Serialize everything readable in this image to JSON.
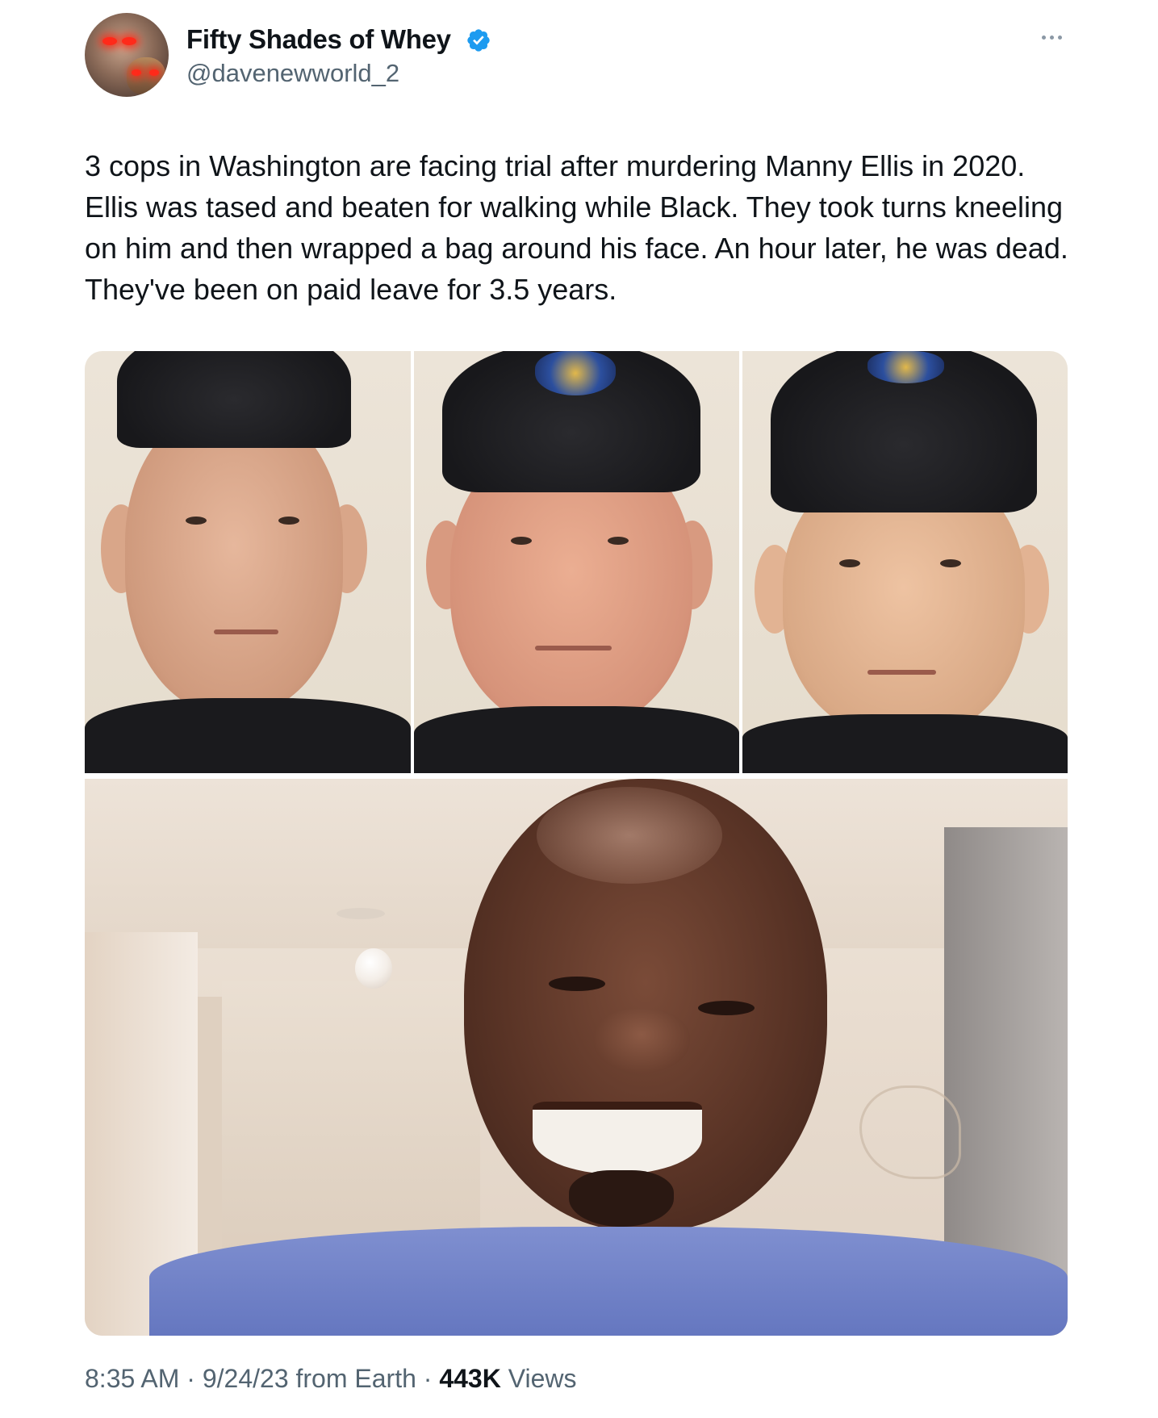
{
  "author": {
    "display_name": "Fifty Shades of Whey",
    "handle": "@davenewworld_2",
    "verified": true,
    "avatar_icon": "profile-avatar"
  },
  "more_icon": "more-options-icon",
  "tweet": {
    "text": "3 cops in Washington are facing trial after murdering Manny Ellis in 2020. Ellis was tased and beaten for walking while Black. They took turns kneeling on him and then wrapped a bag around his face. An hour later, he was dead. They've been on paid leave for 3.5 years."
  },
  "media": {
    "photo_count": 4
  },
  "footer": {
    "time": "8:35 AM",
    "separator_1": " · ",
    "date": "9/24/23",
    "source": " from Earth",
    "separator_2": " · ",
    "views_count": "443K",
    "views_label": " Views"
  },
  "colors": {
    "text_primary": "#0f1419",
    "text_secondary": "#536471",
    "verified_blue": "#1d9bf0"
  }
}
